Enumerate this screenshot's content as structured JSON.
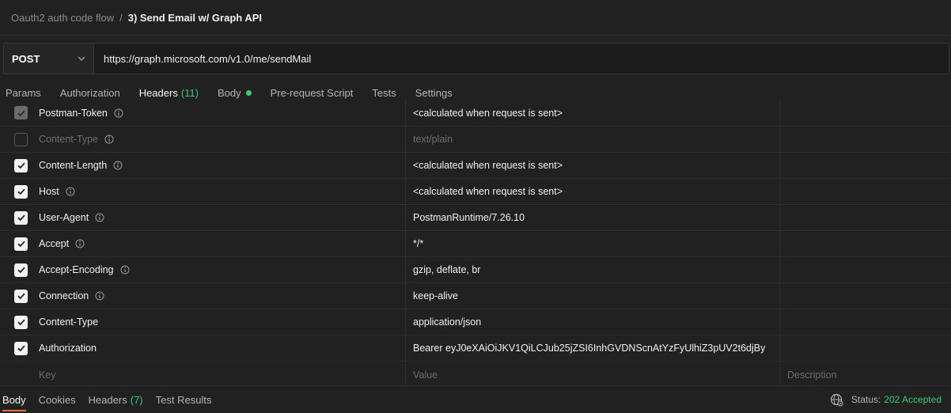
{
  "breadcrumb": {
    "parent": "Oauth2 auth code flow",
    "separator": "/",
    "current": "3) Send Email w/ Graph API"
  },
  "request": {
    "method": "POST",
    "url": "https://graph.microsoft.com/v1.0/me/sendMail"
  },
  "tabs": {
    "params": "Params",
    "authorization": "Authorization",
    "headers": "Headers",
    "headers_count": "(11)",
    "body": "Body",
    "prerequest": "Pre-request Script",
    "tests": "Tests",
    "settings": "Settings"
  },
  "headers": [
    {
      "key": "Postman-Token",
      "value": "<calculated when request is sent>",
      "checked": "locked",
      "info": true
    },
    {
      "key": "Content-Type",
      "value": "text/plain",
      "checked": "off",
      "info": true
    },
    {
      "key": "Content-Length",
      "value": "<calculated when request is sent>",
      "checked": "on",
      "info": true
    },
    {
      "key": "Host",
      "value": "<calculated when request is sent>",
      "checked": "on",
      "info": true
    },
    {
      "key": "User-Agent",
      "value": "PostmanRuntime/7.26.10",
      "checked": "on",
      "info": true
    },
    {
      "key": "Accept",
      "value": "*/*",
      "checked": "on",
      "info": true
    },
    {
      "key": "Accept-Encoding",
      "value": "gzip, deflate, br",
      "checked": "on",
      "info": true
    },
    {
      "key": "Connection",
      "value": "keep-alive",
      "checked": "on",
      "info": true
    },
    {
      "key": "Content-Type",
      "value": "application/json",
      "checked": "on",
      "info": false
    },
    {
      "key": "Authorization",
      "value": "Bearer eyJ0eXAiOiJKV1QiLCJub25jZSI6InhGVDNScnAtYzFyUlhiZ3pUV2t6djBy",
      "checked": "on",
      "info": false
    }
  ],
  "new_row": {
    "key_placeholder": "Key",
    "value_placeholder": "Value",
    "description_placeholder": "Description"
  },
  "response": {
    "body": "Body",
    "cookies": "Cookies",
    "headers": "Headers",
    "headers_count": "(7)",
    "test_results": "Test Results",
    "status_label": "Status:",
    "status_value": "202 Accepted"
  },
  "colors": {
    "accent": "#ff6c37",
    "success": "#3cc97a"
  }
}
